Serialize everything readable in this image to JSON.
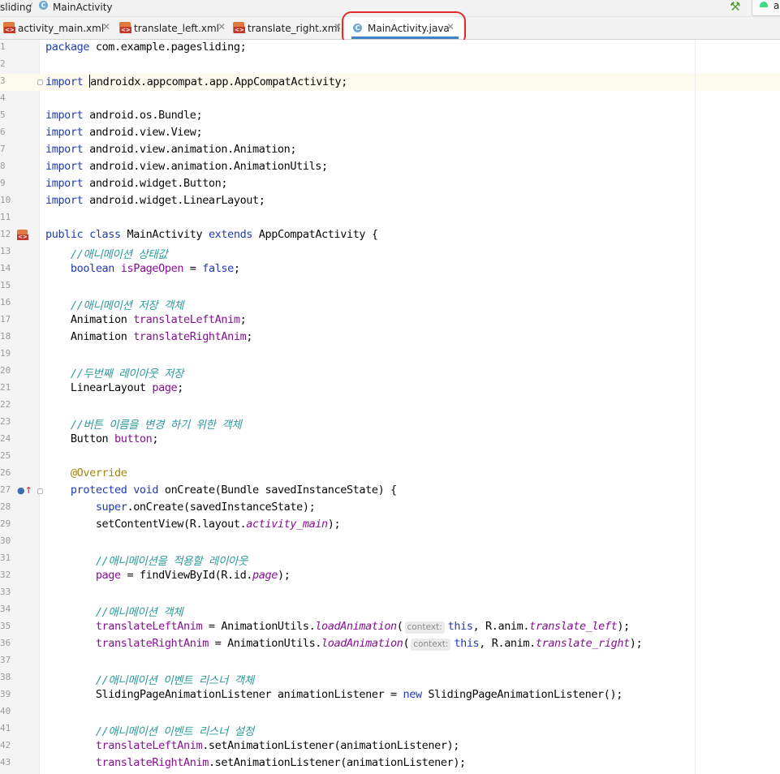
{
  "navbar": {
    "crumb_project": "sliding",
    "crumb_file": "MainActivity",
    "run_config_label": "a"
  },
  "tabs": [
    {
      "label": "activity_main.xml",
      "icon": "xml-layout-icon",
      "active": false
    },
    {
      "label": "translate_left.xml",
      "icon": "xml-layout-icon",
      "active": false
    },
    {
      "label": "translate_right.xml",
      "icon": "xml-layout-icon",
      "active": false
    },
    {
      "label": "MainActivity.java",
      "icon": "java-class-icon",
      "active": true
    }
  ],
  "colors": {
    "keyword": "#1f3bb8",
    "field": "#871094",
    "comment": "#2e9a9a",
    "annotation": "#9e880d",
    "highlight_box": "#e32b2b",
    "active_tab_underline": "#4083c9"
  },
  "editor": {
    "current_line": 3,
    "lines": [
      [
        {
          "t": "package",
          "c": "kw"
        },
        {
          "t": " com.example.pagesliding;"
        }
      ],
      [],
      [
        {
          "t": "import",
          "c": "kw"
        },
        {
          "t": " "
        },
        {
          "caret": true
        },
        {
          "t": "androidx.appcompat.app.AppCompatActivity;"
        }
      ],
      [],
      [
        {
          "t": "import",
          "c": "kw"
        },
        {
          "t": " android.os.Bundle;"
        }
      ],
      [
        {
          "t": "import",
          "c": "kw"
        },
        {
          "t": " android.view.View;"
        }
      ],
      [
        {
          "t": "import",
          "c": "kw"
        },
        {
          "t": " android.view.animation.Animation;"
        }
      ],
      [
        {
          "t": "import",
          "c": "kw"
        },
        {
          "t": " android.view.animation.AnimationUtils;"
        }
      ],
      [
        {
          "t": "import",
          "c": "kw"
        },
        {
          "t": " android.widget.Button;"
        }
      ],
      [
        {
          "t": "import",
          "c": "kw"
        },
        {
          "t": " android.widget.LinearLayout;"
        }
      ],
      [],
      [
        {
          "t": "public class",
          "c": "kw"
        },
        {
          "t": " MainActivity "
        },
        {
          "t": "extends",
          "c": "kw"
        },
        {
          "t": " AppCompatActivity {"
        }
      ],
      [
        {
          "t": "    "
        },
        {
          "t": "//애니메이션 상태값",
          "c": "cm"
        }
      ],
      [
        {
          "t": "    "
        },
        {
          "t": "boolean",
          "c": "kw"
        },
        {
          "t": " "
        },
        {
          "t": "isPageOpen",
          "c": "fld"
        },
        {
          "t": " = "
        },
        {
          "t": "false",
          "c": "kw"
        },
        {
          "t": ";"
        }
      ],
      [],
      [
        {
          "t": "    "
        },
        {
          "t": "//애니메이션 저장 객체",
          "c": "cm"
        }
      ],
      [
        {
          "t": "    Animation "
        },
        {
          "t": "translateLeftAnim",
          "c": "fld"
        },
        {
          "t": ";"
        }
      ],
      [
        {
          "t": "    Animation "
        },
        {
          "t": "translateRightAnim",
          "c": "fld"
        },
        {
          "t": ";"
        }
      ],
      [],
      [
        {
          "t": "    "
        },
        {
          "t": "//두번째 레이아웃 저장",
          "c": "cm"
        }
      ],
      [
        {
          "t": "    LinearLayout "
        },
        {
          "t": "page",
          "c": "fld"
        },
        {
          "t": ";"
        }
      ],
      [],
      [
        {
          "t": "    "
        },
        {
          "t": "//버튼 이름을 변경 하기 위한 객체",
          "c": "cm"
        }
      ],
      [
        {
          "t": "    Button "
        },
        {
          "t": "button",
          "c": "fld"
        },
        {
          "t": ";"
        }
      ],
      [],
      [
        {
          "t": "    "
        },
        {
          "t": "@Override",
          "c": "ann"
        }
      ],
      [
        {
          "t": "    "
        },
        {
          "t": "protected void",
          "c": "kw"
        },
        {
          "t": " onCreate(Bundle savedInstanceState) {"
        }
      ],
      [
        {
          "t": "        "
        },
        {
          "t": "super",
          "c": "kw"
        },
        {
          "t": ".onCreate(savedInstanceState);"
        }
      ],
      [
        {
          "t": "        setContentView(R.layout."
        },
        {
          "t": "activity_main",
          "c": "stc"
        },
        {
          "t": ");"
        }
      ],
      [],
      [
        {
          "t": "        "
        },
        {
          "t": "//애니메이션을 적용할 레이아웃",
          "c": "cm"
        }
      ],
      [
        {
          "t": "        "
        },
        {
          "t": "page",
          "c": "fld"
        },
        {
          "t": " = findViewById(R.id."
        },
        {
          "t": "page",
          "c": "stc"
        },
        {
          "t": ");"
        }
      ],
      [],
      [
        {
          "t": "        "
        },
        {
          "t": "//애니메이션 객체",
          "c": "cm"
        }
      ],
      [
        {
          "t": "        "
        },
        {
          "t": "translateLeftAnim",
          "c": "fld"
        },
        {
          "t": " = AnimationUtils."
        },
        {
          "t": "loadAnimation",
          "c": "stc"
        },
        {
          "t": "("
        },
        {
          "hint": "context:"
        },
        {
          "t": "this",
          "c": "kw"
        },
        {
          "t": ", R.anim."
        },
        {
          "t": "translate_left",
          "c": "stc"
        },
        {
          "t": ");"
        }
      ],
      [
        {
          "t": "        "
        },
        {
          "t": "translateRightAnim",
          "c": "fld"
        },
        {
          "t": " = AnimationUtils."
        },
        {
          "t": "loadAnimation",
          "c": "stc"
        },
        {
          "t": "("
        },
        {
          "hint": "context:"
        },
        {
          "t": "this",
          "c": "kw"
        },
        {
          "t": ", R.anim."
        },
        {
          "t": "translate_right",
          "c": "stc"
        },
        {
          "t": ");"
        }
      ],
      [],
      [
        {
          "t": "        "
        },
        {
          "t": "//애니메이션 이벤트 리스너 객체",
          "c": "cm"
        }
      ],
      [
        {
          "t": "        SlidingPageAnimationListener animationListener = "
        },
        {
          "t": "new",
          "c": "kw"
        },
        {
          "t": " SlidingPageAnimationListener();"
        }
      ],
      [],
      [
        {
          "t": "        "
        },
        {
          "t": "//애니메이션 이벤트 리스너 설정",
          "c": "cm"
        }
      ],
      [
        {
          "t": "        "
        },
        {
          "t": "translateLeftAnim",
          "c": "fld"
        },
        {
          "t": ".setAnimationListener(animationListener);"
        }
      ],
      [
        {
          "t": "        "
        },
        {
          "t": "translateRightAnim",
          "c": "fld"
        },
        {
          "t": ".setAnimationListener(animationListener);"
        }
      ]
    ]
  }
}
